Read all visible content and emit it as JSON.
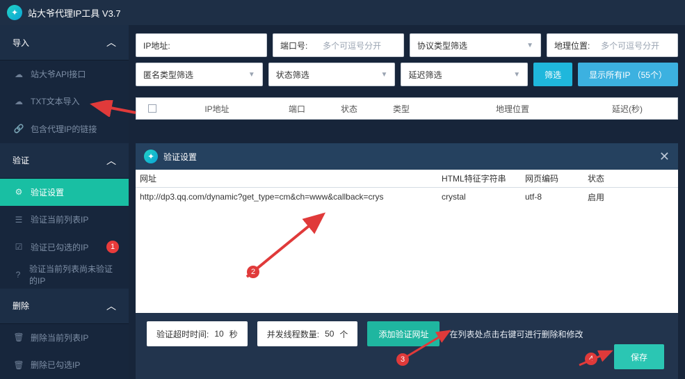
{
  "app": {
    "title": "站大爷代理IP工具 V3.7"
  },
  "sidebar": {
    "groups": [
      {
        "label": "导入",
        "items": [
          {
            "icon": "☁",
            "label": "站大爷API接口"
          },
          {
            "icon": "☁",
            "label": "TXT文本导入"
          },
          {
            "icon": "🔗",
            "label": "包含代理IP的链接"
          }
        ]
      },
      {
        "label": "验证",
        "items": [
          {
            "icon": "⚙",
            "label": "验证设置",
            "active": true
          },
          {
            "icon": "☰",
            "label": "验证当前列表IP"
          },
          {
            "icon": "☑",
            "label": "验证已勾选的IP",
            "badge": "1"
          },
          {
            "icon": "?",
            "label": "验证当前列表尚未验证的IP"
          }
        ]
      },
      {
        "label": "删除",
        "items": [
          {
            "icon": "🗑",
            "label": "删除当前列表IP"
          },
          {
            "icon": "🗑",
            "label": "删除已勾选IP"
          }
        ]
      }
    ]
  },
  "filters": {
    "row1": [
      {
        "label": "IP地址:",
        "placeholder": ""
      },
      {
        "label": "端口号:",
        "placeholder": "多个可逗号分开"
      },
      {
        "label": "协议类型筛选",
        "dropdown": true
      },
      {
        "label": "地理位置:",
        "placeholder": "多个可逗号分开"
      }
    ],
    "row2": [
      {
        "label": "匿名类型筛选",
        "dropdown": true
      },
      {
        "label": "状态筛选",
        "dropdown": true
      },
      {
        "label": "延迟筛选",
        "dropdown": true
      }
    ],
    "btn_filter": "筛选",
    "btn_showall": "显示所有IP （55个）"
  },
  "table_header": {
    "cols": [
      "IP地址",
      "端口",
      "状态",
      "类型",
      "地理位置",
      "延迟(秒)"
    ]
  },
  "modal": {
    "title": "验证设置",
    "table": {
      "head": [
        "网址",
        "HTML特征字符串",
        "网页编码",
        "状态"
      ],
      "rows": [
        {
          "url": "http://dp3.qq.com/dynamic?get_type=cm&ch=www&callback=crys",
          "feat": "crystal",
          "enc": "utf-8",
          "status": "启用"
        }
      ]
    },
    "timeout_label": "验证超时时间:",
    "timeout_value": "10",
    "timeout_unit": "秒",
    "threads_label": "并发线程数量:",
    "threads_value": "50",
    "threads_unit": "个",
    "btn_add": "添加验证网址",
    "hint": "在列表处点击右键可进行删除和修改",
    "btn_save": "保存"
  },
  "anno": {
    "b2": "2",
    "b3": "3",
    "b4": "4"
  }
}
